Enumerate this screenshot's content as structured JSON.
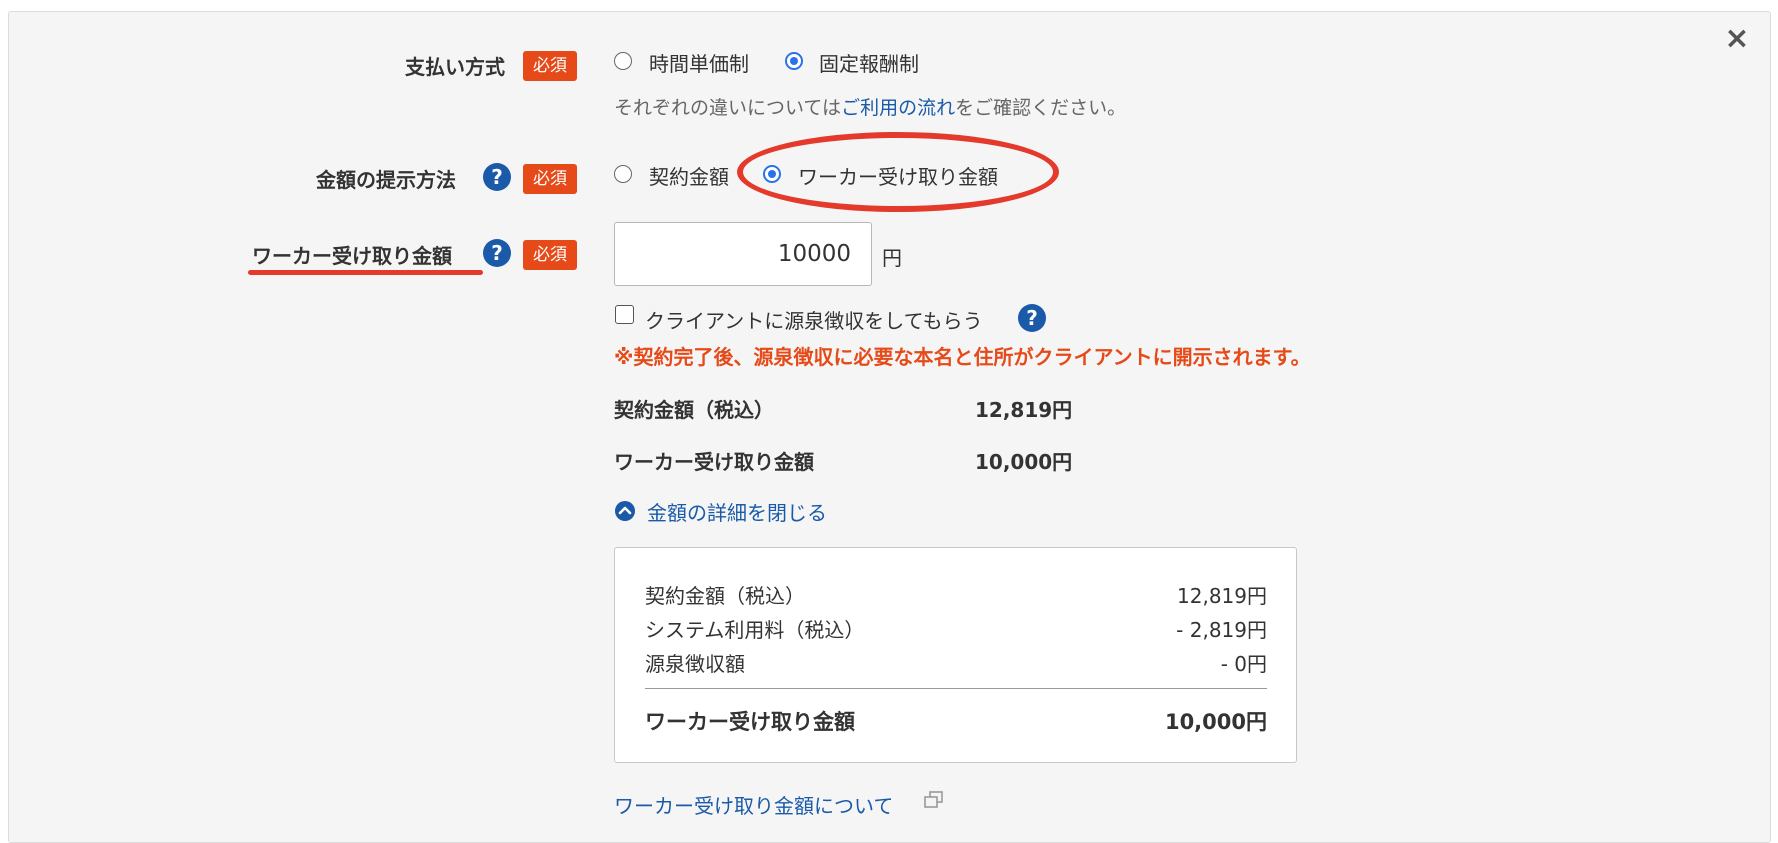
{
  "close": {
    "icon": "×"
  },
  "payment_method": {
    "label": "支払い方式",
    "required": "必須",
    "options": [
      "時間単価制",
      "固定報酬制"
    ],
    "selected": "固定報酬制",
    "note_prefix": "それぞれの違いについては",
    "note_link": "ご利用の流れ",
    "note_suffix": "をご確認ください。"
  },
  "amount_method": {
    "label": "金額の提示方法",
    "help": "?",
    "required": "必須",
    "options": [
      "契約金額",
      "ワーカー受け取り金額"
    ],
    "selected": "ワーカー受け取り金額"
  },
  "worker_amount": {
    "label": "ワーカー受け取り金額",
    "help": "?",
    "required": "必須",
    "value": "10000",
    "unit": "円"
  },
  "withholding": {
    "label": "クライアントに源泉徴収をしてもらう",
    "help": "?",
    "checked": false,
    "warning": "※契約完了後、源泉徴収に必要な本名と住所がクライアントに開示されます。"
  },
  "summary": [
    {
      "label": "契約金額（税込）",
      "value": "12,819円"
    },
    {
      "label": "ワーカー受け取り金額",
      "value": "10,000円"
    }
  ],
  "toggle_details": {
    "label": "金額の詳細を閉じる",
    "icon": "chevron-up-circle-icon"
  },
  "details": [
    {
      "label": "契約金額（税込）",
      "value": "12,819円"
    },
    {
      "label": "システム利用料（税込）",
      "value": "- 2,819円"
    },
    {
      "label": "源泉徴収額",
      "value": "- 0円"
    }
  ],
  "details_total": {
    "label": "ワーカー受け取り金額",
    "value": "10,000円"
  },
  "about_link": {
    "label": "ワーカー受け取り金額について"
  },
  "colors": {
    "accent": "#1a5aa8",
    "required": "#e64a19",
    "radio": "#2a72e8",
    "annotation": "#e33a2b"
  }
}
